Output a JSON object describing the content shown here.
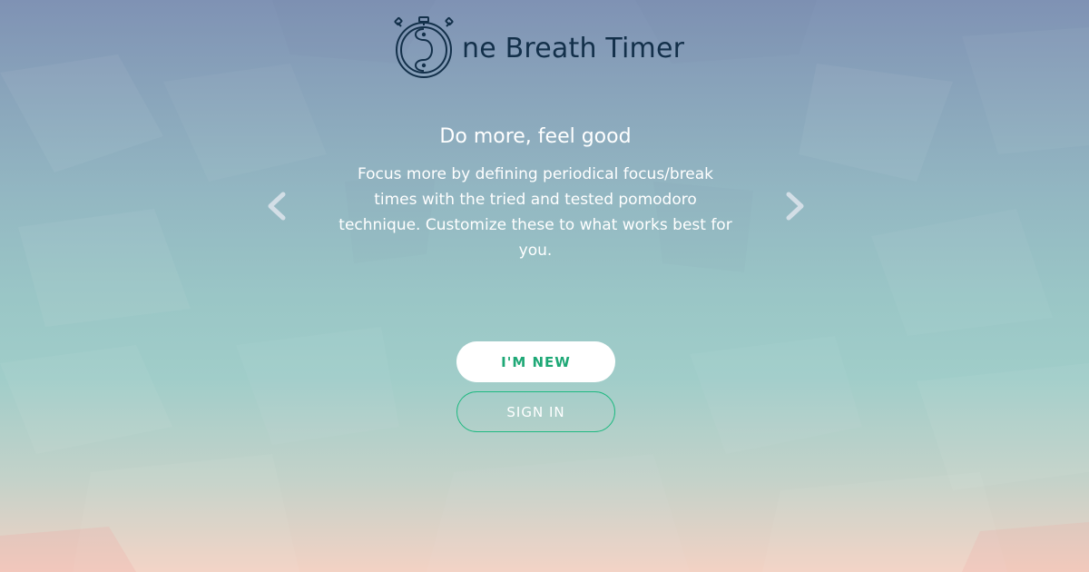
{
  "brand": {
    "logo_text": "ne Breath Timer",
    "logo_icon": "stopwatch-yin-yang-icon",
    "text_color": "#13304a"
  },
  "carousel": {
    "title": "Do more, feel good",
    "body": "Focus more by defining periodical focus/break times with the tried and tested pomodoro technique. Customize these to what works best for you.",
    "prev_icon": "chevron-left-icon",
    "next_icon": "chevron-right-icon"
  },
  "actions": {
    "new_label": "I'M NEW",
    "signin_label": "SIGN IN",
    "accent_color": "#1ea876"
  }
}
